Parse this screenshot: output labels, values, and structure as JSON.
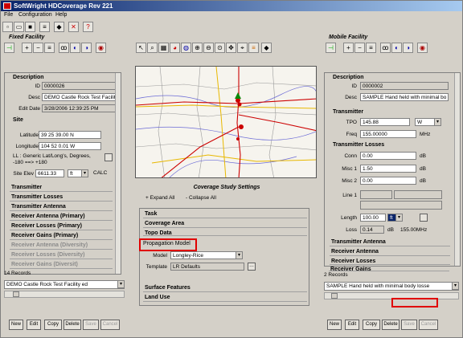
{
  "window": {
    "title": "SoftWright HDCoverage Rev 221"
  },
  "menu": [
    "File",
    "Configuration",
    "Help"
  ],
  "fixed": {
    "panel_title": "Fixed Facility",
    "description_header": "Description",
    "id_label": "ID",
    "id": "0000026",
    "desc_label": "Desc",
    "desc": "DEMO Castle Rock Test Facilit",
    "edit_label": "Edit Date",
    "edit_date": "3/28/2006 12:39:25 PM",
    "site_header": "Site",
    "lat_label": "Latitude",
    "lat": "39 25 39.00 N",
    "lon_label": "Longitude",
    "lon": "104 52 0.01 W",
    "ll_text1": "LL : Generic Lat/Long's, Degrees,",
    "ll_text2": "-180 ==> +180",
    "elev_label": "Site Elev",
    "elev": "6611.33",
    "elev_unit": "ft",
    "calc": "CALC",
    "rows": [
      "Transmitter",
      "Transmitter Losses",
      "Transmitter Antenna",
      "Receiver Antenna (Primary)",
      "Receiver Losses (Primary)",
      "Receiver Gains (Primary)"
    ],
    "dim_rows": [
      "Receiver Antenna (Diversity)",
      "Receiver Losses (Diversity)",
      "Receiver Gains (Diversit)"
    ],
    "records": "14 Records",
    "selector": "DEMO Castle Rock Test Facility ed",
    "buttons": [
      "New",
      "Edit",
      "Copy",
      "Delete",
      "Save",
      "Cancel"
    ]
  },
  "mobile": {
    "panel_title": "Mobile Facility",
    "description_header": "Description",
    "id_label": "ID",
    "id": "0000002",
    "desc_label": "Desc",
    "desc": "SAMPLE Hand held with minimal bo",
    "tx_header": "Transmitter",
    "tpo_label": "TPO",
    "tpo": "145.88",
    "tpo_unit": "W",
    "freq_label": "Freq",
    "freq": "155.00000",
    "freq_unit": "MHz",
    "txloss_header": "Transmitter Losses",
    "conn_label": "Conn",
    "conn": "0.00",
    "db": "dB",
    "misc1_label": "Misc 1",
    "misc1": "1.50",
    "misc2_label": "Misc 2",
    "misc2": "0.00",
    "line1_label": "Line 1",
    "length_label": "Length",
    "length": "100.00",
    "length_unit": "ft",
    "loss_label": "Loss",
    "loss": "0.14",
    "loss_unit": "dB",
    "loss_freq": "155.00MHz",
    "rows": [
      "Transmitter Antenna",
      "Receiver Antenna",
      "Receiver Losses",
      "Receiver Gains"
    ],
    "records": "2 Records",
    "selector": "SAMPLE Hand held with minimal body losse",
    "buttons": [
      "New",
      "Edit",
      "Copy",
      "Delete",
      "Save",
      "Cancel"
    ]
  },
  "study": {
    "title": "Coverage Study Settings",
    "expand": "+ Expand All",
    "collapse": "- Collapse All",
    "rows": [
      "Task",
      "Coverage Area",
      "Topo Data"
    ],
    "prop_header": "Propagation Model",
    "model_label": "Model",
    "model": "Longley-Rice",
    "template_label": "Template",
    "template": "LR Defaults",
    "rows_after": [
      "Surface Features",
      "Land Use"
    ]
  },
  "colors": {
    "title_start": "#0a246a",
    "highlight": "#e00000"
  }
}
